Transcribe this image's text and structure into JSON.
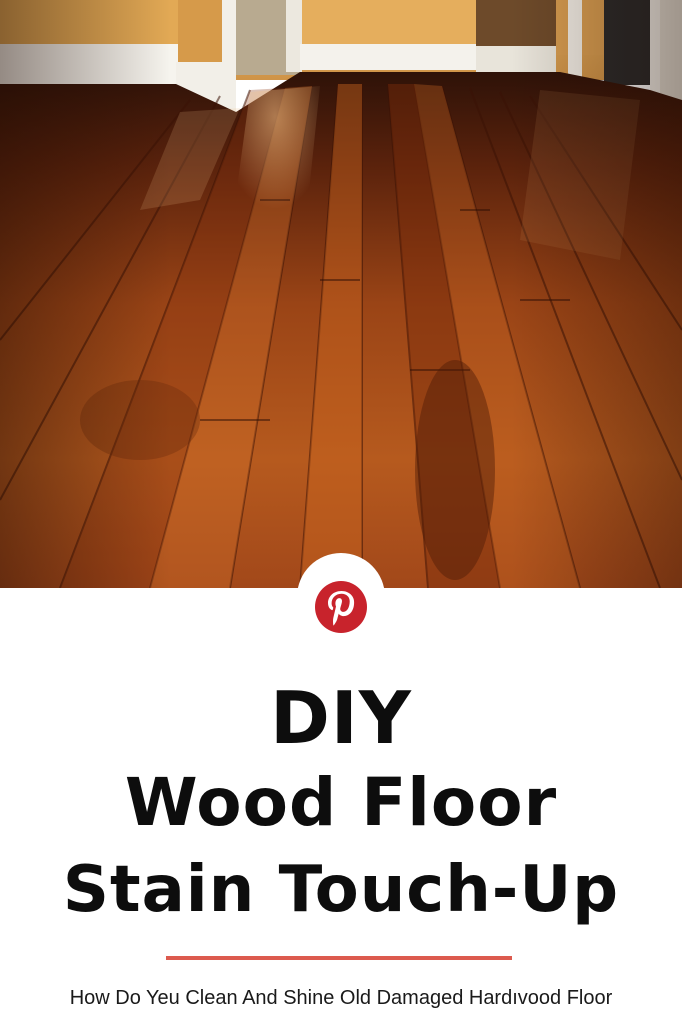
{
  "pin": {
    "title_line_1": "DIY",
    "title_line_2": "Wood Floor",
    "title_line_3": "Stain Touch-Up",
    "subtitle": "How Do Yeu Clean And Shine Old Damaged Hardıvood Floor",
    "logo_icon": "pinterest-icon"
  },
  "colors": {
    "accent_line": "#dc5a4e",
    "pinterest_red": "#c8232c",
    "wall": "#d9a252",
    "floor_mid": "#b0521a",
    "floor_dark": "#5a1c08"
  }
}
